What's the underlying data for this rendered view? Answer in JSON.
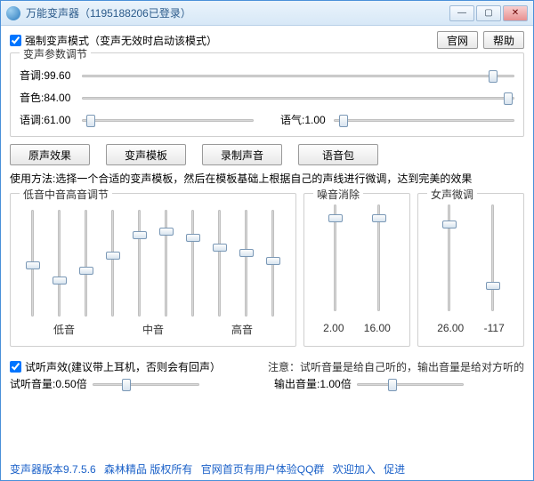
{
  "window": {
    "title": "万能变声器（1195188206已登录）"
  },
  "top": {
    "force_mode_label": "强制变声模式（变声无效时启动该模式）",
    "force_mode_checked": true,
    "btn_site": "官网",
    "btn_help": "帮助"
  },
  "params": {
    "group_title": "变声参数调节",
    "pitch_label": "音调:99.60",
    "pitch_pos": 0.96,
    "timbre_label": "音色:84.00",
    "timbre_pos": 0.995,
    "tone_label": "语调:61.00",
    "tone_pos": 0.03,
    "mood_label": "语气:1.00",
    "mood_pos": 0.03
  },
  "buttons": {
    "original": "原声效果",
    "template": "变声模板",
    "record": "录制声音",
    "voicepack": "语音包"
  },
  "usage": "使用方法:选择一个合适的变声模板，然后在模板基础上根据自己的声线进行微调，达到完美的效果",
  "eq": {
    "title": "低音中音高音调节",
    "positions": [
      0.52,
      0.68,
      0.58,
      0.42,
      0.22,
      0.18,
      0.24,
      0.34,
      0.4,
      0.48
    ],
    "labels": {
      "low": "低音",
      "mid": "中音",
      "high": "高音"
    }
  },
  "noise": {
    "title": "噪音消除",
    "positions": [
      0.1,
      0.1
    ],
    "values": {
      "a": "2.00",
      "b": "16.00"
    }
  },
  "female": {
    "title": "女声微调",
    "positions": [
      0.16,
      0.78
    ],
    "values": {
      "a": "26.00",
      "b": "-117"
    }
  },
  "listen": {
    "checkbox_label": "试听声效(建议带上耳机，否则会有回声）",
    "checked": true,
    "note": "注意：试听音量是给自己听的，输出音量是给对方听的",
    "listen_vol_label": "试听音量:0.50倍",
    "listen_vol_pos": 0.3,
    "output_vol_label": "输出音量:1.00倍",
    "output_vol_pos": 0.32
  },
  "footer": {
    "a": "变声器版本9.7.5.6",
    "b": "森林精品 版权所有",
    "c": "官网首页有用户体验QQ群",
    "d": "欢迎加入",
    "e": "促进"
  }
}
